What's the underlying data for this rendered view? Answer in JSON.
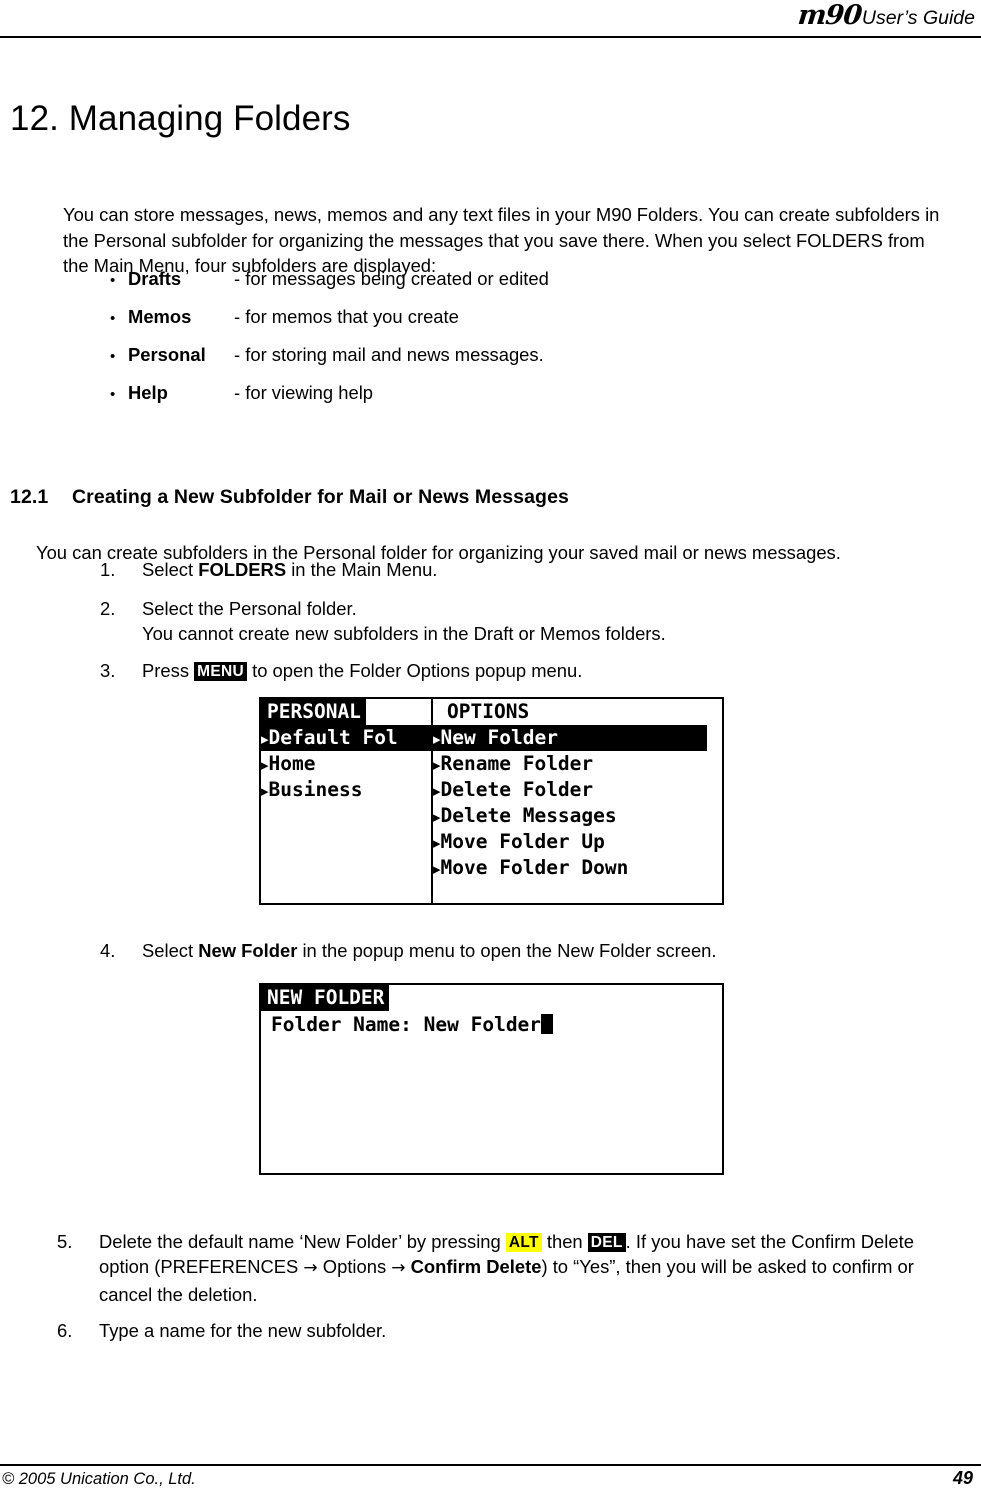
{
  "header": {
    "logo": "m90",
    "title": "User’s Guide"
  },
  "chapter": {
    "title": "12. Managing Folders"
  },
  "intro": {
    "paragraph": "You can store messages, news, memos and any text files in your M90 Folders. You can create subfolders in the Personal subfolder for organizing the messages that you save there. When you select FOLDERS from the Main Menu, four subfolders are displayed:"
  },
  "folders": [
    {
      "bullet": "•",
      "term": "Drafts",
      "desc": "- for messages being created or edited"
    },
    {
      "bullet": "•",
      "term": "Memos",
      "desc": "- for memos that you create"
    },
    {
      "bullet": "•",
      "term": "Personal",
      "desc": "- for storing mail and news messages."
    },
    {
      "bullet": "•",
      "term": "Help",
      "desc": "- for viewing help"
    }
  ],
  "section": {
    "number": "12.1",
    "title": "Creating a New Subfolder for Mail or News Messages",
    "intro": "You can create subfolders in the Personal folder for organizing your saved mail or news messages."
  },
  "steps": {
    "s1": {
      "num": "1.",
      "pre": "Select ",
      "bold": "FOLDERS",
      "post": " in the Main Menu."
    },
    "s2": {
      "num": "2.",
      "line1": "Select the Personal folder.",
      "line2": "You cannot create new subfolders in the Draft or Memos folders."
    },
    "s3": {
      "num": "3.",
      "pre": "Press ",
      "key": "MENU",
      "post": " to open the Folder Options popup menu."
    },
    "s4": {
      "num": "4.",
      "pre": "Select ",
      "bold": "New Folder",
      "post": " in the popup menu to open the New Folder screen."
    },
    "s5": {
      "num": "5.",
      "p1": "Delete the default name ‘New Folder’ by pressing ",
      "key_alt": "ALT",
      "p2": " then ",
      "key_del": "DEL",
      "p3": ". If you have set the Confirm Delete option (PREFERENCES ",
      "arrow1": "→",
      "p4": " Options ",
      "arrow2": "→",
      "p5": " ",
      "bold": "Confirm Delete",
      "p6": ") to “Yes”, then you will be asked to confirm or cancel the deletion."
    },
    "s6": {
      "num": "6.",
      "text": "Type a name for the new subfolder."
    }
  },
  "screen_folders": {
    "left_pane": {
      "title": "PERSONAL",
      "items": [
        {
          "marker": "▸",
          "label": "Default Fol",
          "highlighted": true
        },
        {
          "marker": "▸",
          "label": "Home",
          "highlighted": false
        },
        {
          "marker": "▸",
          "label": "Business",
          "highlighted": false
        }
      ]
    },
    "right_pane": {
      "title": "OPTIONS",
      "items": [
        {
          "marker": "▸",
          "label": "New Folder",
          "highlighted": true
        },
        {
          "marker": "▸",
          "label": "Rename Folder",
          "highlighted": false
        },
        {
          "marker": "▸",
          "label": "Delete Folder",
          "highlighted": false
        },
        {
          "marker": "▸",
          "label": "Delete Messages",
          "highlighted": false
        },
        {
          "marker": "▸",
          "label": "Move Folder Up",
          "highlighted": false
        },
        {
          "marker": "▸",
          "label": "Move Folder Down",
          "highlighted": false
        }
      ]
    }
  },
  "screen_newfolder": {
    "title": "NEW FOLDER",
    "field_label": "Folder Name:",
    "field_value": "New Folder"
  },
  "footer": {
    "copyright": "© 2005 Unication Co., Ltd.",
    "page_number": "49"
  },
  "colors": {
    "highlight_key": "#ffff00",
    "invert_bg": "#000000",
    "invert_fg": "#ffffff",
    "page_bg": "#ffffff",
    "text": "#000000"
  }
}
